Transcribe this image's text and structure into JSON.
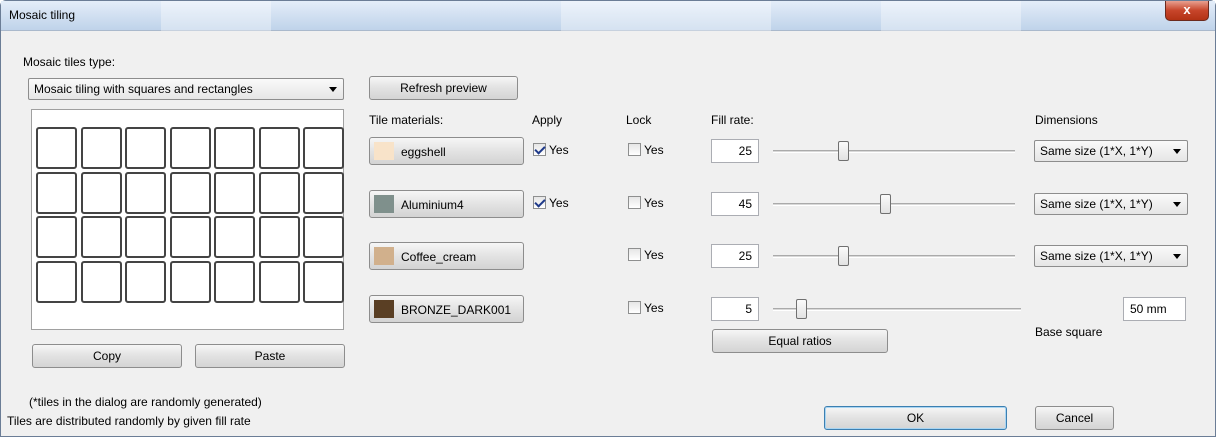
{
  "window": {
    "title": "Mosaic tiling",
    "close_symbol": "x"
  },
  "tiles_type": {
    "label": "Mosaic tiles type:",
    "selected": "Mosaic tiling with squares and rectangles"
  },
  "preview": {
    "rows": 4,
    "cols": 7
  },
  "buttons": {
    "refresh": "Refresh preview",
    "copy": "Copy",
    "paste": "Paste",
    "equal_ratios": "Equal ratios",
    "ok": "OK",
    "cancel": "Cancel"
  },
  "headers": {
    "materials": "Tile materials:",
    "apply": "Apply",
    "lock": "Lock",
    "fill_rate": "Fill rate:",
    "dimensions": "Dimensions"
  },
  "materials": [
    {
      "name": "eggshell",
      "color": "#f8e3c9",
      "apply_shown": true,
      "apply_checked": true,
      "apply_label": "Yes",
      "lock_checked": false,
      "lock_label": "Yes",
      "fill_rate": "25",
      "fill_rate_value": 25,
      "dimension": "Same size (1*X, 1*Y)"
    },
    {
      "name": "Aluminium4",
      "color": "#7f908c",
      "apply_shown": true,
      "apply_checked": true,
      "apply_label": "Yes",
      "lock_checked": false,
      "lock_label": "Yes",
      "fill_rate": "45",
      "fill_rate_value": 45,
      "dimension": "Same size (1*X, 1*Y)"
    },
    {
      "name": "Coffee_cream",
      "color": "#d1b08c",
      "apply_shown": false,
      "apply_checked": false,
      "apply_label": "",
      "lock_checked": false,
      "lock_label": "Yes",
      "fill_rate": "25",
      "fill_rate_value": 25,
      "dimension": "Same size (1*X, 1*Y)"
    },
    {
      "name": "BRONZE_DARK001",
      "color": "#5a3f24",
      "apply_shown": false,
      "apply_checked": false,
      "apply_label": "",
      "lock_checked": false,
      "lock_label": "Yes",
      "fill_rate": "5",
      "fill_rate_value": 5,
      "dimension": ""
    }
  ],
  "base_square": {
    "label": "Base square",
    "value": "50 mm"
  },
  "notes": {
    "random": "(*tiles in the dialog are randomly generated)",
    "status": "Tiles are distributed randomly by given fill rate"
  }
}
